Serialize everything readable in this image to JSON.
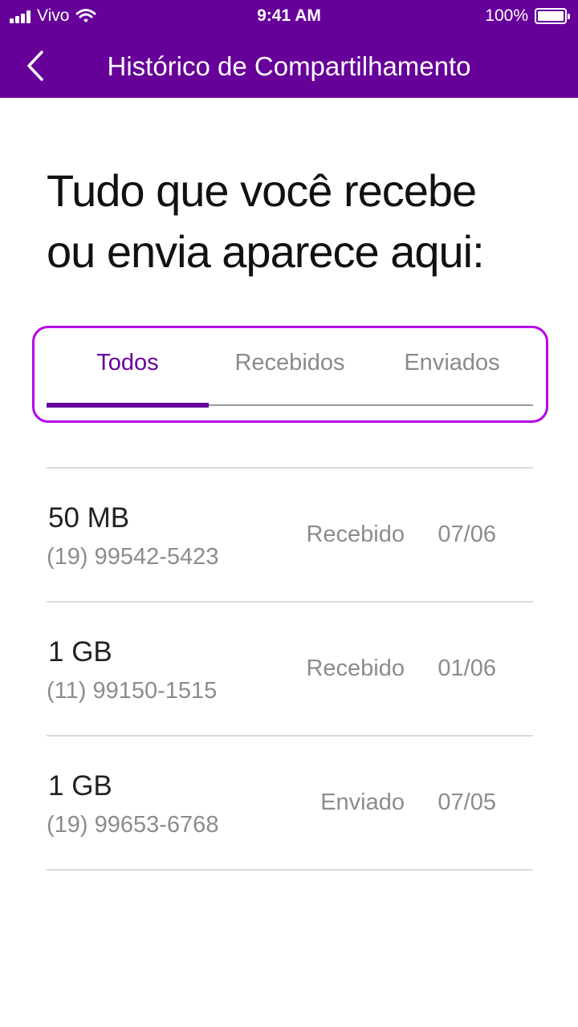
{
  "status_bar": {
    "carrier": "Vivo",
    "time": "9:41 AM",
    "battery": "100%"
  },
  "header": {
    "title": "Histórico de Compartilhamento",
    "back_icon": "chevron-left-icon"
  },
  "headline": {
    "line1": "Tudo que você recebe",
    "line2": "ou envia aparece aqui:"
  },
  "tabs": [
    {
      "label": "Todos",
      "active": true
    },
    {
      "label": "Recebidos",
      "active": false
    },
    {
      "label": "Enviados",
      "active": false
    }
  ],
  "history": [
    {
      "amount": "50 MB",
      "phone": "(19) 99542-5423",
      "type": "Recebido",
      "date": "07/06"
    },
    {
      "amount": "1 GB",
      "phone": "(11) 99150-1515",
      "type": "Recebido",
      "date": "01/06"
    },
    {
      "amount": "1 GB",
      "phone": "(19) 99653-6768",
      "type": "Enviado",
      "date": "07/05"
    }
  ],
  "colors": {
    "brand": "#660099",
    "highlight_border": "#b400e6"
  }
}
